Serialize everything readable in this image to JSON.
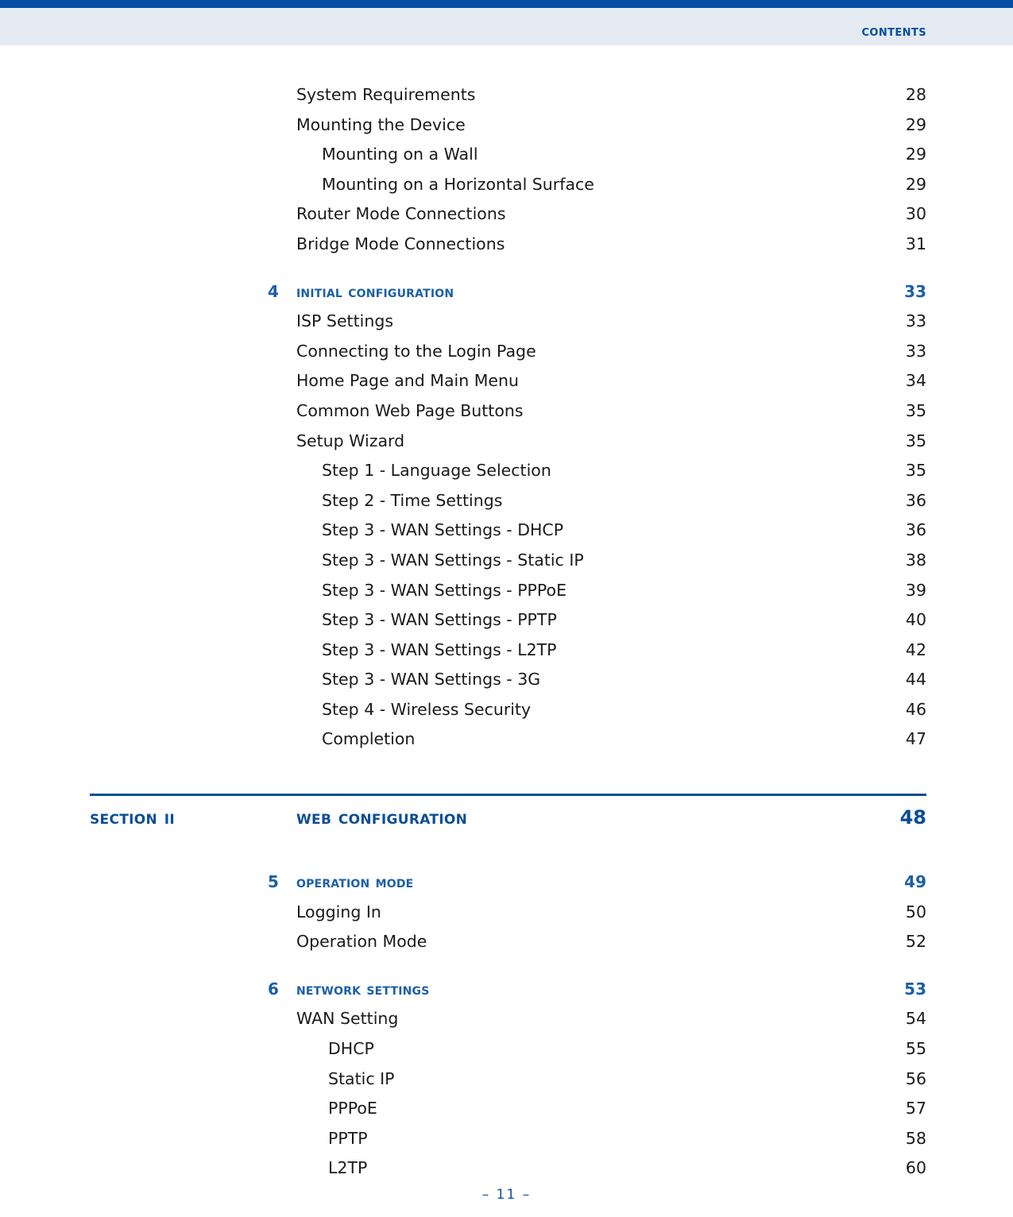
{
  "header": {
    "title": "Contents"
  },
  "footer": {
    "page_marker": "–  11  –"
  },
  "colors": {
    "header_rule": "#034EA2",
    "header_band": "#E4EAF2",
    "heading_blue": "#1B5FA8",
    "section_blue": "#0B4E96",
    "body_text": "#1a1a1a"
  },
  "section_divider": {
    "name": "Section II",
    "title": "Web Configuration",
    "page": "48"
  },
  "entries": [
    {
      "level": 1,
      "label": "System Requirements",
      "page": "28"
    },
    {
      "level": 1,
      "label": "Mounting the Device",
      "page": "29"
    },
    {
      "level": 2,
      "label": "Mounting on a Wall",
      "page": "29"
    },
    {
      "level": 2,
      "label": "Mounting on a Horizontal Surface",
      "page": "29"
    },
    {
      "level": 1,
      "label": "Router Mode Connections",
      "page": "30"
    },
    {
      "level": 1,
      "label": "Bridge Mode Connections",
      "page": "31"
    },
    {
      "level": 0,
      "number": "4",
      "label": "Initial Configuration",
      "page": "33"
    },
    {
      "level": 1,
      "label": "ISP Settings",
      "page": "33"
    },
    {
      "level": 1,
      "label": "Connecting to the Login Page",
      "page": "33"
    },
    {
      "level": 1,
      "label": "Home Page and Main Menu",
      "page": "34"
    },
    {
      "level": 1,
      "label": "Common Web Page Buttons",
      "page": "35"
    },
    {
      "level": 1,
      "label": "Setup Wizard",
      "page": "35"
    },
    {
      "level": 2,
      "label": "Step 1 - Language Selection",
      "page": "35"
    },
    {
      "level": 2,
      "label": "Step 2 - Time Settings",
      "page": "36"
    },
    {
      "level": 2,
      "label": "Step 3 - WAN Settings - DHCP",
      "page": "36"
    },
    {
      "level": 2,
      "label": "Step 3 - WAN Settings - Static IP",
      "page": "38"
    },
    {
      "level": 2,
      "label": "Step 3 - WAN Settings - PPPoE",
      "page": "39"
    },
    {
      "level": 2,
      "label": "Step 3 - WAN Settings - PPTP",
      "page": "40"
    },
    {
      "level": 2,
      "label": "Step 3 - WAN Settings - L2TP",
      "page": "42"
    },
    {
      "level": 2,
      "label": "Step 3 - WAN Settings - 3G",
      "page": "44"
    },
    {
      "level": 2,
      "label": "Step 4 - Wireless Security",
      "page": "46"
    },
    {
      "level": 2,
      "label": "Completion",
      "page": "47"
    }
  ],
  "entries_after_section": [
    {
      "level": 0,
      "number": "5",
      "label": "Operation Mode",
      "page": "49"
    },
    {
      "level": 1,
      "label": "Logging In",
      "page": "50"
    },
    {
      "level": 1,
      "label": "Operation Mode",
      "page": "52"
    },
    {
      "level": 0,
      "number": "6",
      "label": "Network Settings",
      "page": "53"
    },
    {
      "level": 1,
      "label": "WAN Setting",
      "page": "54"
    },
    {
      "level": 3,
      "label": "DHCP",
      "page": "55"
    },
    {
      "level": 3,
      "label": "Static IP",
      "page": "56"
    },
    {
      "level": 3,
      "label": "PPPoE",
      "page": "57"
    },
    {
      "level": 3,
      "label": "PPTP",
      "page": "58"
    },
    {
      "level": 3,
      "label": "L2TP",
      "page": "60"
    }
  ]
}
